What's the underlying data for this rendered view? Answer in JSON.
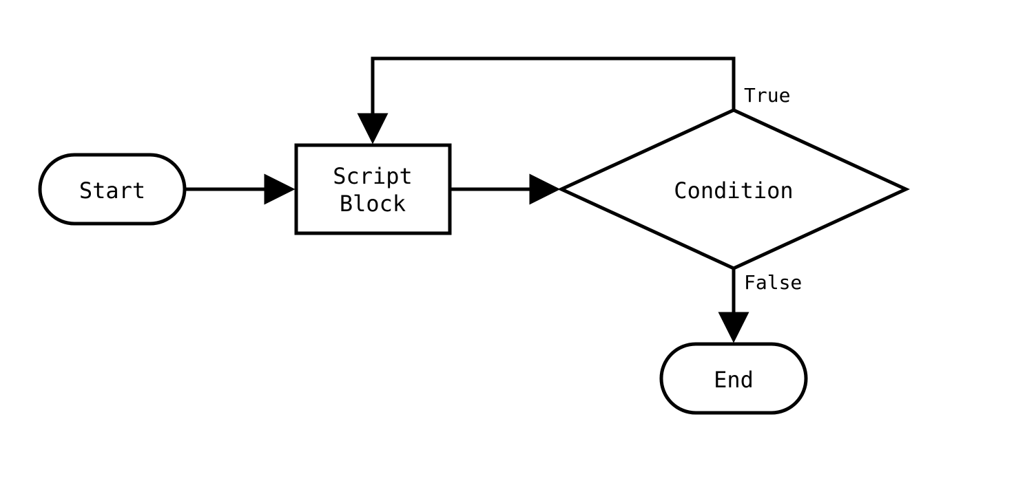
{
  "diagram": {
    "type": "flowchart",
    "nodes": {
      "start": {
        "label": "Start",
        "shape": "terminator"
      },
      "script": {
        "label_line1": "Script",
        "label_line2": "Block",
        "shape": "process"
      },
      "condition": {
        "label": "Condition",
        "shape": "decision"
      },
      "end": {
        "label": "End",
        "shape": "terminator"
      }
    },
    "edges": {
      "true_label": "True",
      "false_label": "False"
    },
    "flow": [
      {
        "from": "start",
        "to": "script"
      },
      {
        "from": "script",
        "to": "condition"
      },
      {
        "from": "condition",
        "to": "script",
        "label": "True"
      },
      {
        "from": "condition",
        "to": "end",
        "label": "False"
      }
    ]
  }
}
